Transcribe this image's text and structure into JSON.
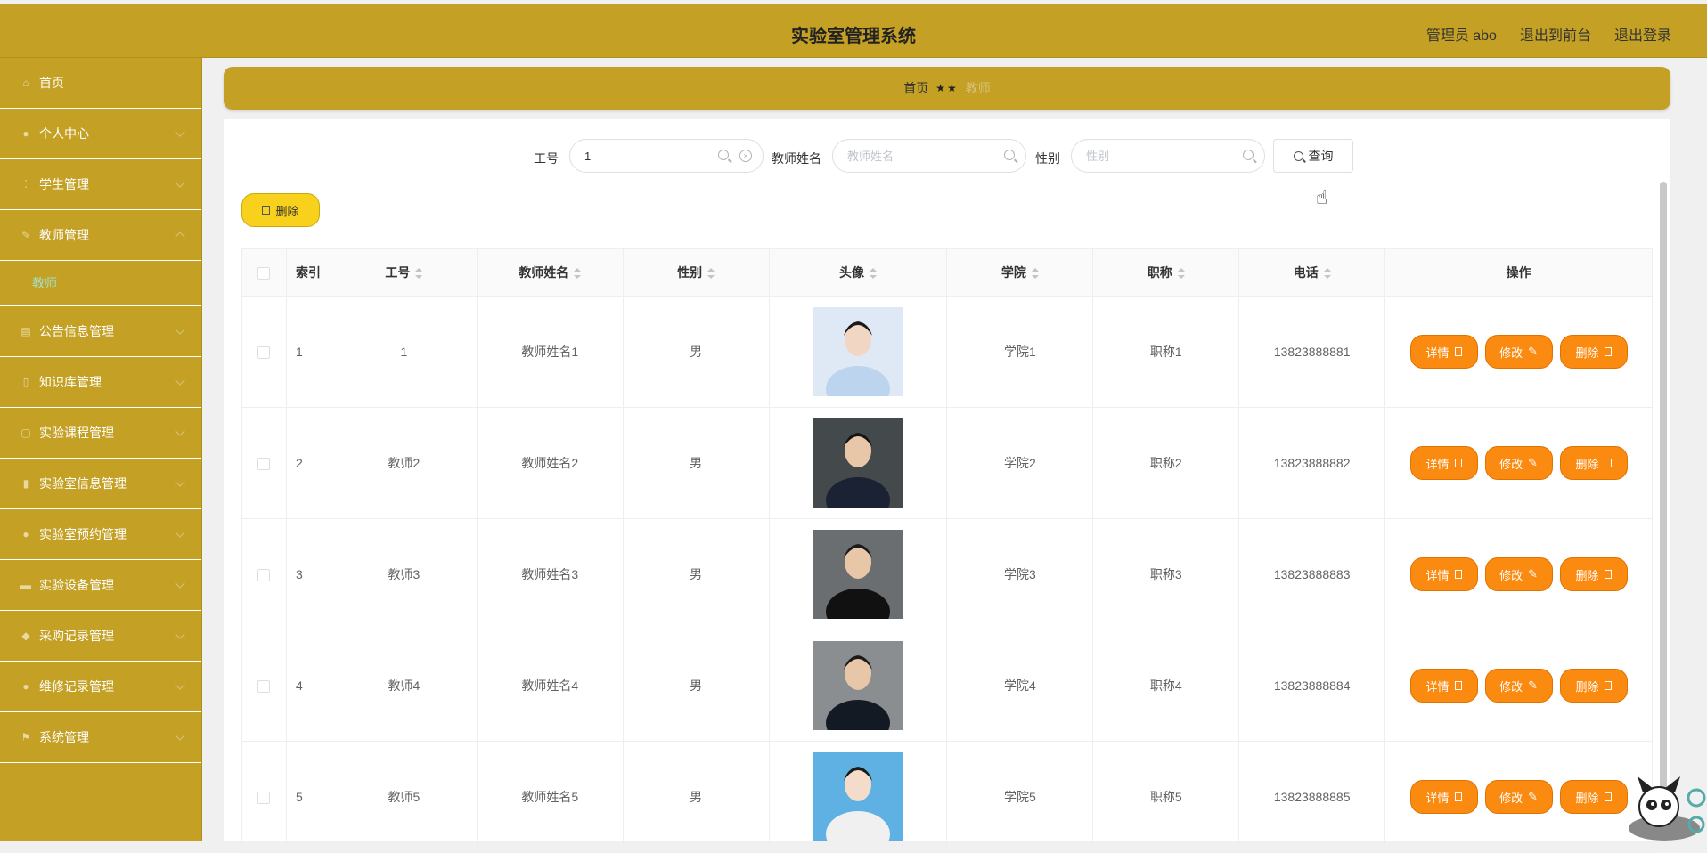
{
  "header": {
    "title": "实验室管理系统",
    "user_label": "管理员 abo",
    "to_front": "退出到前台",
    "logout": "退出登录"
  },
  "sidebar": {
    "items": [
      {
        "label": "首页",
        "icon": "home-icon"
      },
      {
        "label": "个人中心",
        "icon": "user-icon"
      },
      {
        "label": "学生管理",
        "icon": "student-icon"
      },
      {
        "label": "教师管理",
        "icon": "teacher-icon",
        "expanded": true,
        "sub": "教师"
      },
      {
        "label": "公告信息管理",
        "icon": "notice-icon"
      },
      {
        "label": "知识库管理",
        "icon": "book-icon"
      },
      {
        "label": "实验课程管理",
        "icon": "course-icon"
      },
      {
        "label": "实验室信息管理",
        "icon": "chart-icon"
      },
      {
        "label": "实验室预约管理",
        "icon": "booking-icon"
      },
      {
        "label": "实验设备管理",
        "icon": "device-icon"
      },
      {
        "label": "采购记录管理",
        "icon": "purchase-icon"
      },
      {
        "label": "维修记录管理",
        "icon": "repair-icon"
      },
      {
        "label": "系统管理",
        "icon": "flag-icon"
      }
    ]
  },
  "breadcrumb": {
    "home": "首页",
    "separator": "★★",
    "current": "教师"
  },
  "search": {
    "id_label": "工号",
    "id_value": "1",
    "name_label": "教师姓名",
    "name_placeholder": "教师姓名",
    "gender_label": "性别",
    "gender_placeholder": "性别",
    "query_label": "查询"
  },
  "actions": {
    "batch_delete": "删除"
  },
  "table": {
    "columns": [
      "索引",
      "工号",
      "教师姓名",
      "性别",
      "头像",
      "学院",
      "职称",
      "电话",
      "操作"
    ],
    "rows": [
      {
        "index": "1",
        "id": "1",
        "name": "教师姓名1",
        "gender": "男",
        "college": "学院1",
        "title": "职称1",
        "phone": "13823888881"
      },
      {
        "index": "2",
        "id": "教师2",
        "name": "教师姓名2",
        "gender": "男",
        "college": "学院2",
        "title": "职称2",
        "phone": "13823888882"
      },
      {
        "index": "3",
        "id": "教师3",
        "name": "教师姓名3",
        "gender": "男",
        "college": "学院3",
        "title": "职称3",
        "phone": "13823888883"
      },
      {
        "index": "4",
        "id": "教师4",
        "name": "教师姓名4",
        "gender": "男",
        "college": "学院4",
        "title": "职称4",
        "phone": "13823888884"
      },
      {
        "index": "5",
        "id": "教师5",
        "name": "教师姓名5",
        "gender": "男",
        "college": "学院5",
        "title": "职称5",
        "phone": "13823888885"
      }
    ],
    "op_detail": "详情",
    "op_edit": "修改",
    "op_delete": "删除"
  },
  "colors": {
    "brand": "#c4a024",
    "action_orange": "#fb8a10",
    "delete_yellow": "#f7d11c",
    "submenu_active": "#a5e0c3"
  }
}
